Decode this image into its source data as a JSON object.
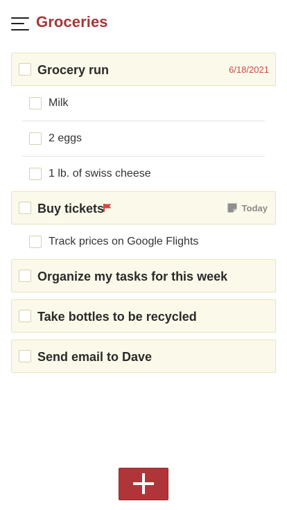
{
  "header": {
    "title": "Groceries",
    "menu_icon": "hamburger-menu-icon"
  },
  "colors": {
    "accent": "#a8353a",
    "task_background": "#fbfaea",
    "task_border": "#e8e3bb",
    "date_red": "#c9474a",
    "flag_red": "#d94545",
    "fab_background": "#b13538"
  },
  "tasks": [
    {
      "label": "Grocery run",
      "date": "6/18/2021",
      "subtasks": [
        {
          "label": "Milk"
        },
        {
          "label": "2 eggs"
        },
        {
          "label": "1 lb. of swiss cheese"
        }
      ]
    },
    {
      "label": "Buy tickets",
      "flag_icon": "red-flag-icon",
      "note_icon": "note-icon",
      "due": "Today",
      "subtasks": [
        {
          "label": "Track prices on Google Flights"
        }
      ]
    },
    {
      "label": "Organize my tasks for this week"
    },
    {
      "label": "Take bottles to be recycled"
    },
    {
      "label": "Send email to Dave"
    }
  ],
  "fab": {
    "icon": "plus-icon"
  }
}
